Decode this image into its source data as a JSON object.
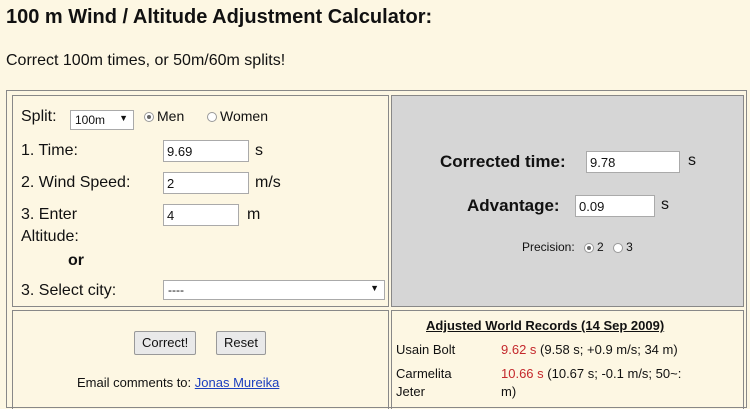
{
  "page": {
    "title": "100 m Wind / Altitude Adjustment Calculator:",
    "subtitle": "Correct 100m times, or 50m/60m splits!"
  },
  "form": {
    "split_label": "Split:",
    "split_value": "100m",
    "gender_options": [
      "Men",
      "Women"
    ],
    "gender_selected": "Men",
    "time_label": "1. Time:",
    "time_value": "9.69",
    "time_unit": "s",
    "wind_label": "2. Wind Speed:",
    "wind_value": "2",
    "wind_unit": "m/s",
    "altitude_label_1": "3. Enter",
    "altitude_label_2": "Altitude:",
    "altitude_value": "4",
    "altitude_unit": "m",
    "or_label": "or",
    "city_label": "3. Select city:",
    "city_value": "----"
  },
  "result": {
    "corrected_label": "Corrected time:",
    "corrected_value": "9.78",
    "corrected_unit": "s",
    "advantage_label": "Advantage:",
    "advantage_value": "0.09",
    "advantage_unit": "s",
    "precision_label": "Precision:",
    "precision_options": [
      "2",
      "3"
    ],
    "precision_selected": "2"
  },
  "actions": {
    "correct_label": "Correct!",
    "reset_label": "Reset",
    "email_prefix": "Email comments to:",
    "email_name": "Jonas Mureika"
  },
  "records": {
    "heading": "Adjusted World Records (14 Sep 2009)",
    "rows": [
      {
        "name": "Usain Bolt",
        "adjusted": "9.62 s",
        "detail": "(9.58 s; +0.9 m/s; 34 m)"
      },
      {
        "name_1": "Carmelita",
        "name_2": "Jeter",
        "adjusted": "10.66 s",
        "detail_1": "(10.67 s; -0.1 m/s; 50~:",
        "detail_2": "m)"
      }
    ]
  },
  "colors": {
    "background": "#fdf7e3",
    "result_panel": "#d6d6d6",
    "record_value": "#c4282c",
    "link": "#1b3fbf"
  }
}
